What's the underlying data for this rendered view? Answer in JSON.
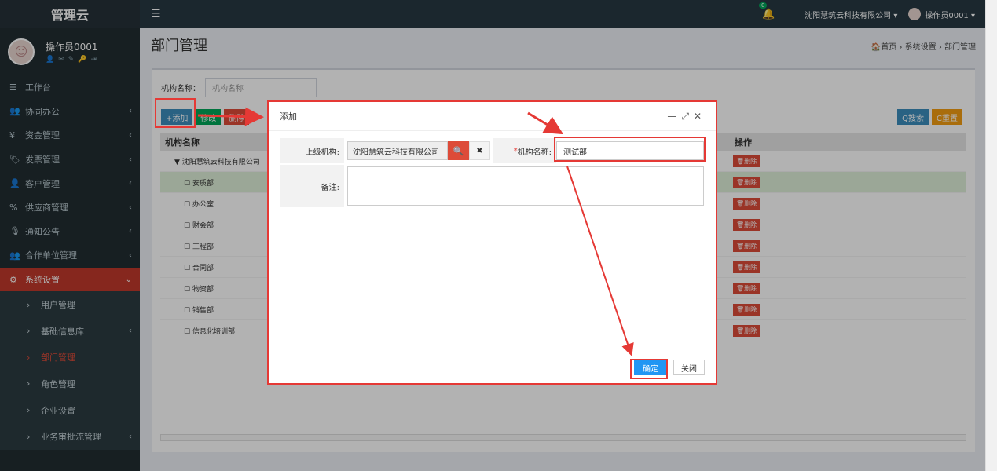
{
  "app": {
    "title": "管理云"
  },
  "user": {
    "name": "操作员0001"
  },
  "menu": [
    {
      "icon": "☰",
      "label": "工作台"
    },
    {
      "icon": "👥",
      "label": "协同办公",
      "chev": "‹"
    },
    {
      "icon": "¥",
      "label": "资金管理",
      "chev": "‹"
    },
    {
      "icon": "🏷",
      "label": "发票管理",
      "chev": "‹"
    },
    {
      "icon": "👤",
      "label": "客户管理",
      "chev": "‹"
    },
    {
      "icon": "%",
      "label": "供应商管理",
      "chev": "‹"
    },
    {
      "icon": "🎙",
      "label": "通知公告",
      "chev": "‹"
    },
    {
      "icon": "👥",
      "label": "合作单位管理",
      "chev": "‹"
    },
    {
      "icon": "⚙",
      "label": "系统设置",
      "chev": "⌄"
    }
  ],
  "submenu": [
    {
      "label": "用户管理"
    },
    {
      "label": "基础信息库",
      "chev": "‹"
    },
    {
      "label": "部门管理"
    },
    {
      "label": "角色管理"
    },
    {
      "label": "企业设置"
    },
    {
      "label": "业务审批流管理",
      "chev": "‹"
    }
  ],
  "topbar": {
    "badge": "0",
    "company": "沈阳慧筑云科技有限公司 ▾",
    "operator": "操作员0001 ▾"
  },
  "header": {
    "title": "部门管理",
    "breadcrumb": "🏠首页 › 系统设置 › 部门管理"
  },
  "search": {
    "label": "机构名称：",
    "placeholder": "机构名称"
  },
  "toolbar": {
    "add": "+添加",
    "edit": "修改",
    "delete": "删除",
    "search": "Q搜索",
    "reset": "C重置"
  },
  "table": {
    "headers": [
      "机构名称",
      "操作"
    ],
    "rows": [
      "沈阳慧筑云科技有限公司",
      "安质部",
      "办公室",
      "财会部",
      "工程部",
      "合同部",
      "物资部",
      "销售部",
      "信息化培训部"
    ],
    "delete_label": "🗑删除"
  },
  "modal": {
    "title": "添加",
    "parent_label": "上级机构:",
    "parent_value": "沈阳慧筑云科技有限公司",
    "name_label": "机构名称:",
    "name_value": "测试部",
    "note_label": "备注:",
    "ok": "确定",
    "close": "关闭"
  },
  "colors": {
    "accent": "#e53935",
    "primary": "#2196f3"
  }
}
